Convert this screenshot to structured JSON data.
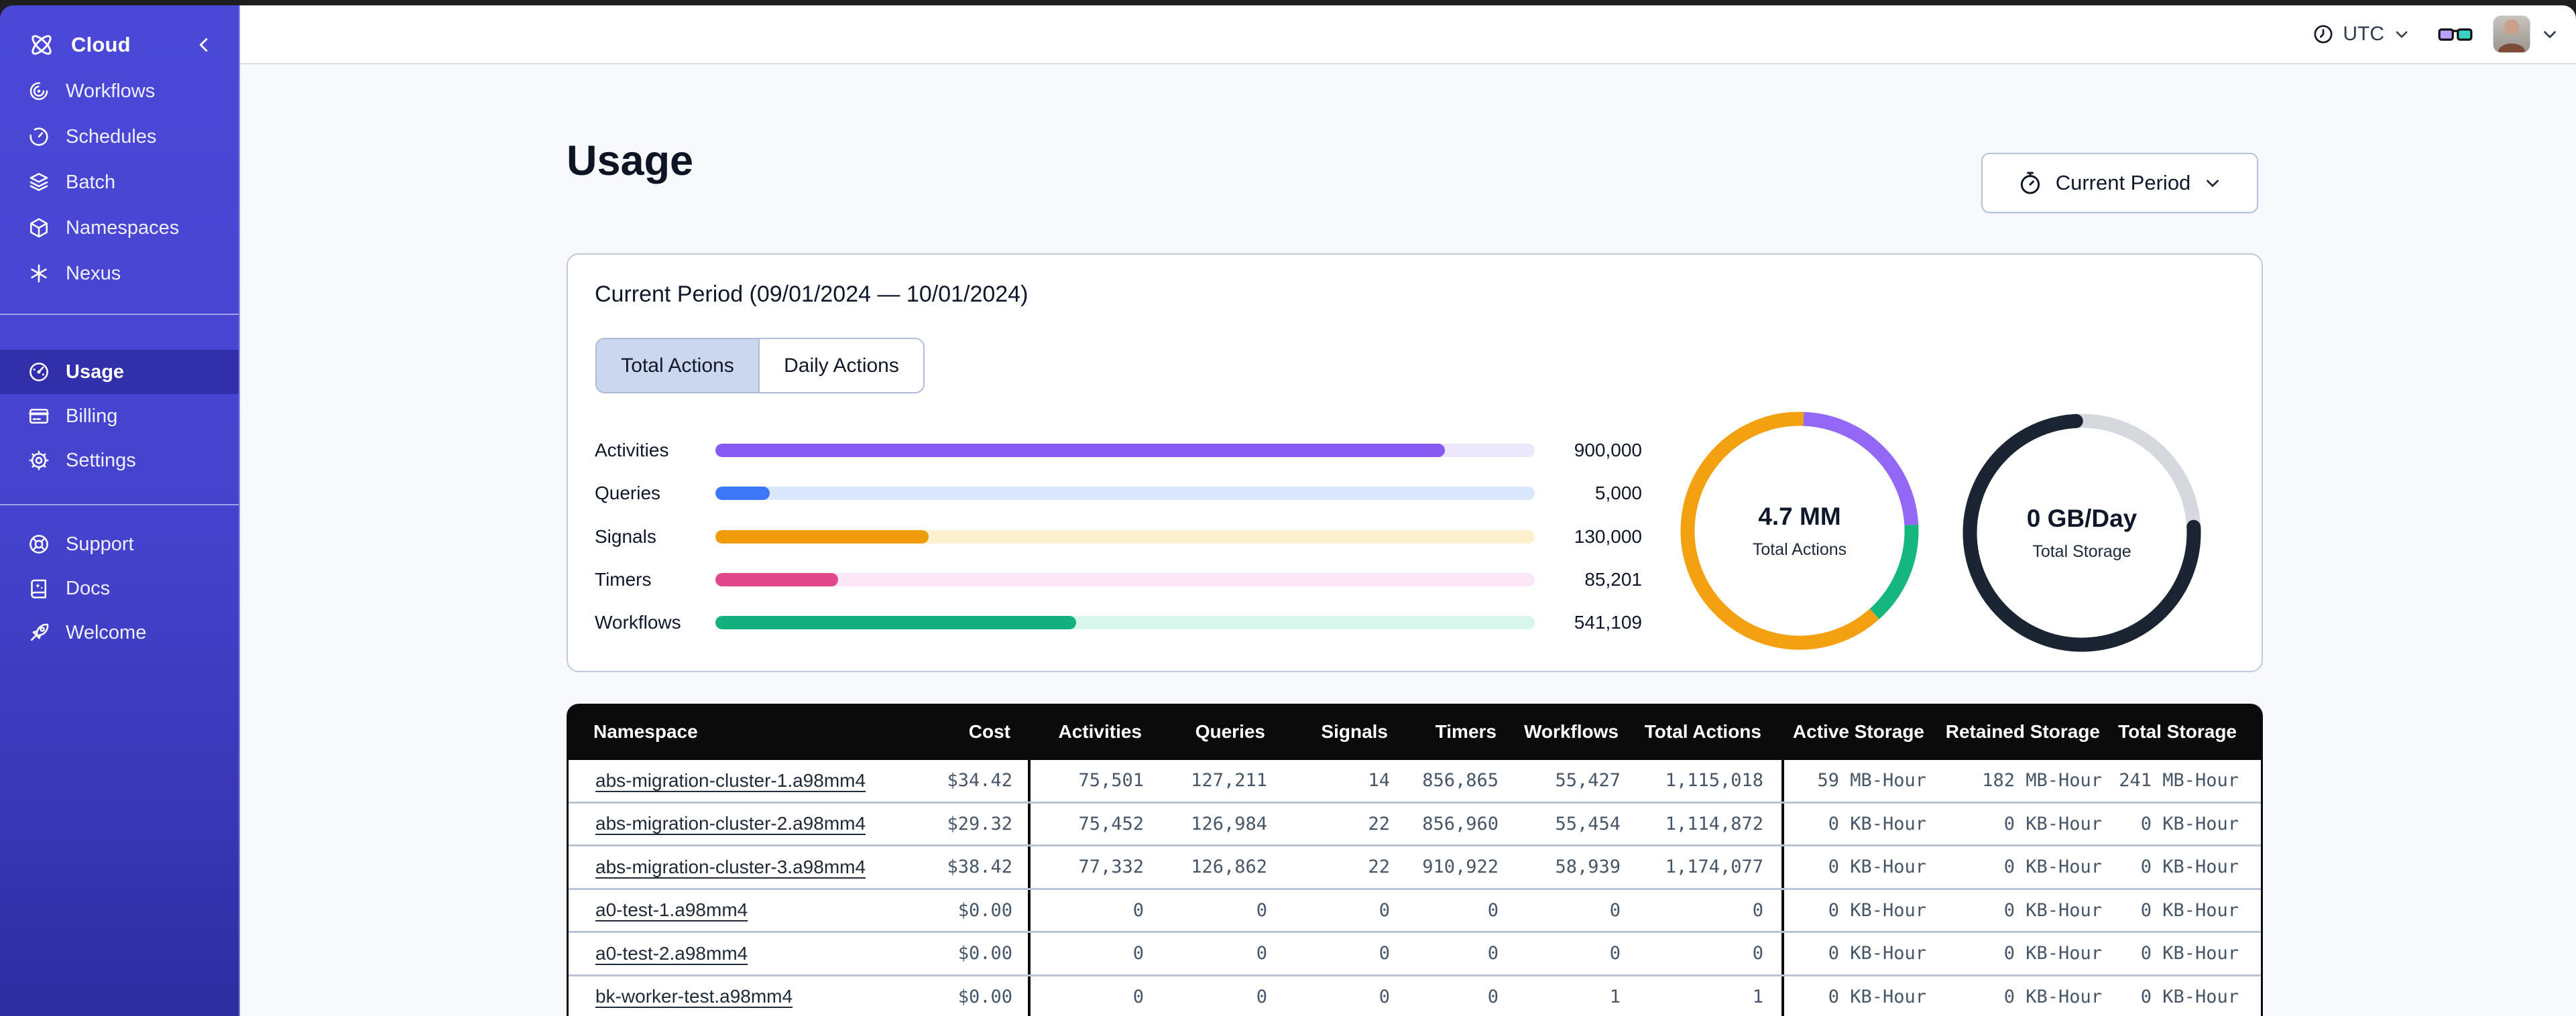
{
  "window": {
    "topbar": {
      "timezone_label": "UTC"
    }
  },
  "theme": {
    "sidebar_top": "#4b48d8",
    "sidebar_bottom": "#2c2da0",
    "active_nav_bg": "#3c39b8",
    "selected_tab_bg": "#cbd7ef",
    "table_header_bg": "#0b0b0c",
    "number_text": "#475569"
  },
  "sidebar": {
    "brand_label": "Cloud",
    "nav_main": [
      {
        "icon": "workflows-icon",
        "label": "Workflows"
      },
      {
        "icon": "schedules-icon",
        "label": "Schedules"
      },
      {
        "icon": "batch-icon",
        "label": "Batch"
      },
      {
        "icon": "namespaces-icon",
        "label": "Namespaces"
      },
      {
        "icon": "nexus-icon",
        "label": "Nexus"
      }
    ],
    "nav_account": [
      {
        "icon": "usage-icon",
        "label": "Usage",
        "active": true
      },
      {
        "icon": "billing-icon",
        "label": "Billing",
        "active": false
      },
      {
        "icon": "settings-icon",
        "label": "Settings",
        "active": false
      }
    ],
    "nav_footer": [
      {
        "icon": "support-icon",
        "label": "Support"
      },
      {
        "icon": "docs-icon",
        "label": "Docs"
      },
      {
        "icon": "welcome-icon",
        "label": "Welcome"
      }
    ]
  },
  "page": {
    "title": "Usage",
    "period_button_label": "Current Period",
    "card": {
      "title": "Current Period (09/01/2024 — 10/01/2024)",
      "tabs": [
        {
          "label": "Total Actions",
          "active": true
        },
        {
          "label": "Daily Actions",
          "active": false
        }
      ]
    }
  },
  "chart_data": [
    {
      "type": "bar",
      "orientation": "horizontal",
      "categories": [
        "Activities",
        "Queries",
        "Signals",
        "Timers",
        "Workflows"
      ],
      "values": [
        900000,
        5000,
        130000,
        85201,
        541109
      ],
      "display_values": [
        "900,000",
        "5,000",
        "130,000",
        "85,201",
        "541,109"
      ],
      "fill_pct": [
        89,
        6.6,
        26,
        15,
        44
      ],
      "colors": [
        "#8759f3",
        "#3b77f6",
        "#f09c0a",
        "#e2478c",
        "#13b07e"
      ],
      "track_colors": [
        "#ece7fd",
        "#d9e6fc",
        "#fcf0cf",
        "#fbe7f6",
        "#d8f6eb"
      ]
    },
    {
      "type": "donut",
      "label": "4.7 MM",
      "sublabel": "Total Actions",
      "segments": [
        {
          "color": "#f4a111",
          "start": 138,
          "end": 362
        },
        {
          "color": "#9468f7",
          "start": 2,
          "end": 87
        },
        {
          "color": "#16b77f",
          "start": 87,
          "end": 138
        }
      ]
    },
    {
      "type": "donut",
      "label": "0 GB/Day",
      "sublabel": "Total Storage",
      "base": "#d5d8dd",
      "segments": [
        {
          "color": "#1b2433",
          "start": 87,
          "end": 357,
          "cap": "round"
        }
      ]
    }
  ],
  "table": {
    "headers": [
      "Namespace",
      "Cost",
      "Activities",
      "Queries",
      "Signals",
      "Timers",
      "Workflows",
      "Total Actions",
      "Active Storage",
      "Retained Storage",
      "Total Storage"
    ],
    "rows": [
      [
        "abs-migration-cluster-1.a98mm4",
        "$34.42",
        "75,501",
        "127,211",
        "14",
        "856,865",
        "55,427",
        "1,115,018",
        "59 MB-Hour",
        "182 MB-Hour",
        "241 MB-Hour"
      ],
      [
        "abs-migration-cluster-2.a98mm4",
        "$29.32",
        "75,452",
        "126,984",
        "22",
        "856,960",
        "55,454",
        "1,114,872",
        "0 KB-Hour",
        "0 KB-Hour",
        "0 KB-Hour"
      ],
      [
        "abs-migration-cluster-3.a98mm4",
        "$38.42",
        "77,332",
        "126,862",
        "22",
        "910,922",
        "58,939",
        "1,174,077",
        "0 KB-Hour",
        "0 KB-Hour",
        "0 KB-Hour"
      ],
      [
        "a0-test-1.a98mm4",
        "$0.00",
        "0",
        "0",
        "0",
        "0",
        "0",
        "0",
        "0 KB-Hour",
        "0 KB-Hour",
        "0 KB-Hour"
      ],
      [
        "a0-test-2.a98mm4",
        "$0.00",
        "0",
        "0",
        "0",
        "0",
        "0",
        "0",
        "0 KB-Hour",
        "0 KB-Hour",
        "0 KB-Hour"
      ],
      [
        "bk-worker-test.a98mm4",
        "$0.00",
        "0",
        "0",
        "0",
        "0",
        "1",
        "1",
        "0 KB-Hour",
        "0 KB-Hour",
        "0 KB-Hour"
      ]
    ]
  }
}
